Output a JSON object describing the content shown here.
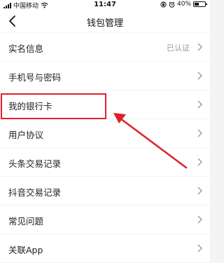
{
  "status_bar": {
    "carrier": "中国移动",
    "time": "11:47",
    "battery": "40%",
    "battery_level": 0.4
  },
  "nav": {
    "title": "钱包管理",
    "back_icon": "chevron-left-icon"
  },
  "menu": {
    "items": [
      {
        "label": "实名信息",
        "value": "已认证"
      },
      {
        "label": "手机号与密码"
      },
      {
        "label": "我的银行卡"
      },
      {
        "label": "用户协议"
      },
      {
        "label": "头条交易记录"
      },
      {
        "label": "抖音交易记录"
      },
      {
        "label": "常见问题"
      },
      {
        "label": "关联App"
      }
    ]
  },
  "annotation": {
    "color": "#e0202a"
  }
}
